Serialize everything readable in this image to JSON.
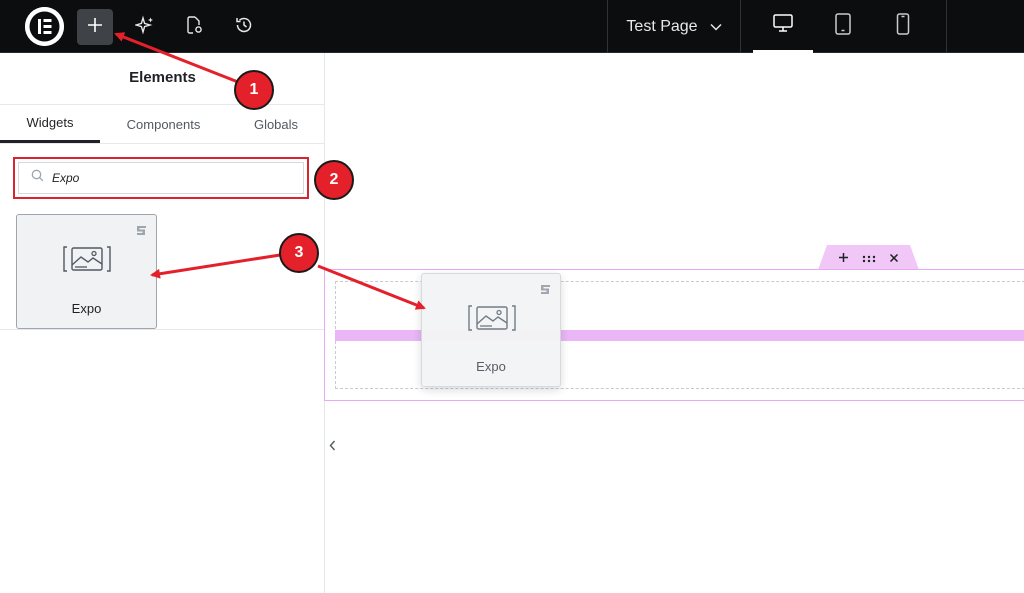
{
  "topbar": {
    "page_title": "Test Page",
    "icons": [
      "elementor-logo-icon",
      "plus-icon",
      "ai-sparkle-icon",
      "page-settings-icon",
      "history-icon",
      "chevron-down-icon",
      "desktop-icon",
      "tablet-icon",
      "mobile-icon"
    ]
  },
  "panel": {
    "title": "Elements",
    "tabs": [
      {
        "label": "Widgets",
        "active": true
      },
      {
        "label": "Components",
        "active": false
      },
      {
        "label": "Globals",
        "active": false
      }
    ],
    "search": {
      "value": "Expo",
      "placeholder": ""
    },
    "widgets": [
      {
        "label": "Expo"
      }
    ]
  },
  "canvas": {
    "dragging_widget": {
      "label": "Expo"
    },
    "section_controls": [
      "plus-icon",
      "drag-handle-icon",
      "close-icon"
    ]
  },
  "callouts": [
    {
      "label": "1"
    },
    {
      "label": "2"
    },
    {
      "label": "3"
    }
  ],
  "colors": {
    "topbar_bg": "#0c0d0e",
    "callout_red": "#e4202a",
    "section_accent": "#e8a9f4",
    "drop_indicator": "#eab6f6"
  }
}
